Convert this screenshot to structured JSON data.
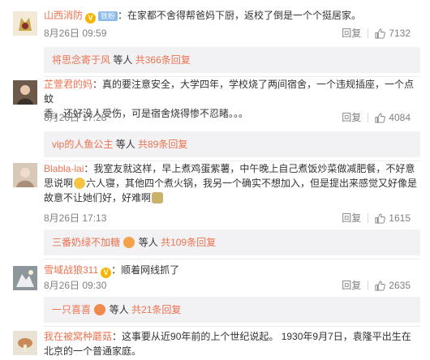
{
  "comments": [
    {
      "user": "山西消防",
      "badge_v": "V",
      "badge_lv": "铁粉",
      "text": "：在家都不舍得帮爸妈下厨，返校了倒是一个个挺居家。",
      "date": "8月26日 09:59",
      "reply_label": "回复",
      "likes": "7132",
      "sub": {
        "name": "将思念寄于风",
        "mid": "等人",
        "count": "共366条回复"
      }
    },
    {
      "user": "芷萱君的妈",
      "text1": "：真的要注意安全，大学四年，学校烧了两间宿舍，一个违规插座，一个点蚊",
      "text2": "香，还好没人受伤，可是宿舍烧得惨不忍睹。。。",
      "date": "8月26日 17:28",
      "reply_label": "回复",
      "likes": "4084",
      "sub": {
        "name": "vip的人鱼公主",
        "mid": "等人",
        "count": "共89条回复"
      }
    },
    {
      "user": "Blabla-lai",
      "text1": "：我室友就这样，早上煮鸡蛋紫薯，中午晚上自己煮饭炒菜做减肥餐，不好意",
      "text2a": "思说啊",
      "text2b": "六人寝，其他四个煮火锅，我另一个确实不想加入，但是提出来感觉又好像是",
      "text3a": "故意不让她们好，好难啊",
      "date": "8月26日 17:13",
      "reply_label": "回复",
      "likes": "1615",
      "sub": {
        "name": "三番奶绿不加糖",
        "mid": "等人",
        "count": "共109条回复"
      }
    },
    {
      "user": "雪域战狼311",
      "badge_v": "V",
      "text": "：顺着网线抓了",
      "date": "8月26日 09:30",
      "reply_label": "回复",
      "likes": "2635",
      "sub": {
        "name": "一只喜喜",
        "mid": "等人",
        "count": "共21条回复"
      }
    },
    {
      "user": "我在被窝种蘑菇",
      "text1": "：这事要从近90年前的上个世纪说起。   1930年9月7日，袁隆平出生在",
      "text2": "北京的一个普通家庭。"
    }
  ],
  "icons": {
    "like": "thumbs-up-icon",
    "verified": "verified-badge-icon",
    "emoji": "emoji-icon"
  },
  "colors": {
    "username": "#eb7350",
    "meta": "#808080",
    "subbox_bg": "#f2f2f5"
  }
}
